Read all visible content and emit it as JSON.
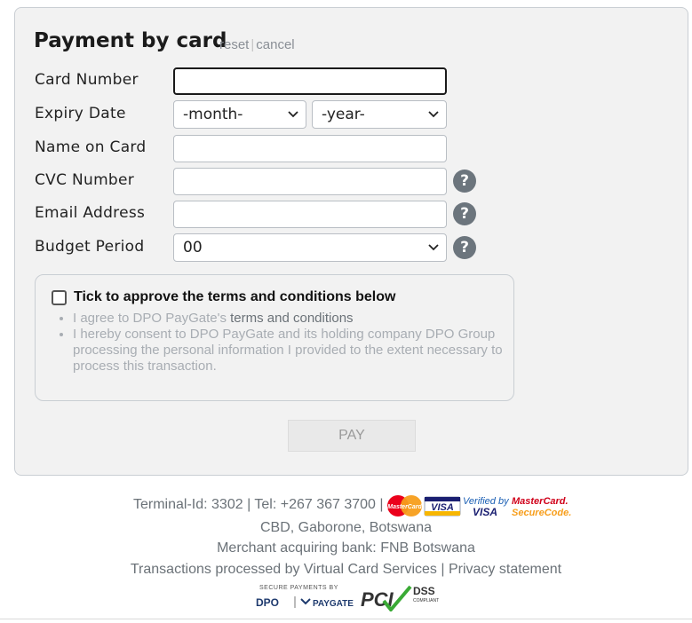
{
  "form": {
    "title": "Payment by card",
    "reset_link": "reset",
    "separator": "|",
    "cancel_link": "cancel",
    "fields": {
      "card_number": {
        "label": "Card Number",
        "value": ""
      },
      "expiry": {
        "label": "Expiry Date",
        "month_selected": "-month-",
        "year_selected": "-year-"
      },
      "name": {
        "label": "Name on Card",
        "value": ""
      },
      "cvc": {
        "label": "CVC Number",
        "value": ""
      },
      "email": {
        "label": "Email Address",
        "value": ""
      },
      "budget": {
        "label": "Budget Period",
        "selected": "00"
      }
    },
    "help_glyph": "?"
  },
  "terms": {
    "heading": "Tick to approve the terms and conditions below",
    "checked": false,
    "item1_prefix": "I agree to DPO PayGate's ",
    "item1_link": "terms and conditions",
    "item2": "I hereby consent to DPO PayGate and its holding company DPO Group processing the personal information I provided to the extent necessary to process this transaction."
  },
  "pay_button": "PAY",
  "footer": {
    "terminal_line": "Terminal-Id: 3302 | Tel: +267 367 3700 |",
    "address": "CBD, Gaborone, Botswana",
    "bank": "Merchant acquiring bank: FNB Botswana",
    "processed_prefix": "Transactions processed by Virtual Card Services | ",
    "privacy_link": "Privacy statement",
    "logos": {
      "mastercard_text": "MasterCard",
      "visa_text": "VISA",
      "verified_text": "Verified by",
      "verified_visa": "VISA",
      "securecode_top": "MasterCard.",
      "securecode_bottom": "SecureCode.",
      "secure_payments_by": "SECURE PAYMENTS BY",
      "dpo": "DPO",
      "paygate": "PAYGATE",
      "pci": "PCI",
      "dss": "DSS",
      "compliant": "COMPLIANT"
    }
  },
  "colors": {
    "panel_bg": "#f2f2f2",
    "help_badge": "#6c757d",
    "mastercard_red": "#eb001b",
    "mastercard_orange": "#f79e1b",
    "visa_blue": "#1a1f71",
    "pci_green": "#3aaa35"
  }
}
